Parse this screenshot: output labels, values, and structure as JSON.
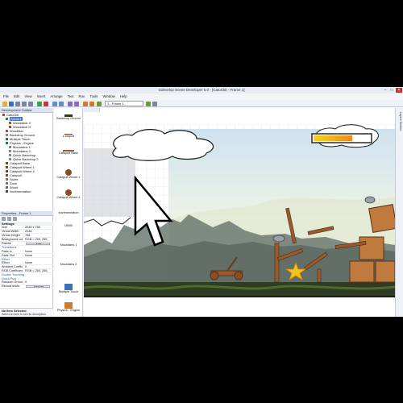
{
  "window": {
    "title": "Gdevelop Scene Developer 5.0 - [CatuCkit - Frame 1]"
  },
  "menu": [
    "File",
    "Edit",
    "View",
    "Insert",
    "Arrange",
    "Text",
    "Run",
    "Tools",
    "Window",
    "Help"
  ],
  "toolbar": {
    "frame_select": "1 - Frame 1"
  },
  "tree": {
    "header": "Development Toolbar",
    "items": [
      {
        "label": "CatuCkit",
        "selected": false,
        "level": 0,
        "color": "#c0392b"
      },
      {
        "label": "Scene1",
        "selected": true,
        "level": 1,
        "color": "#2e7d32"
      },
      {
        "label": "Woodstick V",
        "selected": false,
        "level": 2,
        "color": "#a0522d"
      },
      {
        "label": "Woodstick H",
        "selected": false,
        "level": 2,
        "color": "#a0522d"
      },
      {
        "label": "WoodBox",
        "selected": false,
        "level": 1,
        "color": "#8b5a2b"
      },
      {
        "label": "Backdrop Ground",
        "selected": false,
        "level": 1,
        "color": "#888888"
      },
      {
        "label": "Multiple Touch",
        "selected": false,
        "level": 1,
        "color": "#2a5db0"
      },
      {
        "label": "Physics - Engine",
        "selected": false,
        "level": 1,
        "color": "#2a5db0"
      },
      {
        "label": "Mountains 1",
        "selected": false,
        "level": 2,
        "color": "#888888"
      },
      {
        "label": "Mountains 2",
        "selected": false,
        "level": 2,
        "color": "#888888"
      },
      {
        "label": "Quick Backdrop",
        "selected": false,
        "level": 2,
        "color": "#888888"
      },
      {
        "label": "Quick Backdrop 2",
        "selected": false,
        "level": 2,
        "color": "#888888"
      },
      {
        "label": "Catapult Base",
        "selected": false,
        "level": 1,
        "color": "#8b4513"
      },
      {
        "label": "Catapult Wheel 1",
        "selected": false,
        "level": 1,
        "color": "#8b4513"
      },
      {
        "label": "Catapult Wheel 4",
        "selected": false,
        "level": 1,
        "color": "#8b4513"
      },
      {
        "label": "Catapult",
        "selected": false,
        "level": 1,
        "color": "#8b4513"
      },
      {
        "label": "Stone",
        "selected": false,
        "level": 1,
        "color": "#777777"
      },
      {
        "label": "Zone",
        "selected": false,
        "level": 1,
        "color": "#777777"
      },
      {
        "label": "Wood",
        "selected": false,
        "level": 1,
        "color": "#a0522d"
      },
      {
        "label": "Incrémentation",
        "selected": false,
        "level": 1,
        "color": "#444444"
      }
    ]
  },
  "properties": {
    "header": "Properties - Frame 1",
    "section_settings": "Settings",
    "rows": [
      {
        "name": "Size",
        "value": "2048 x 768"
      },
      {
        "name": "Virtual Width",
        "value": "2048"
      },
      {
        "name": "Virtual Height",
        "value": "768"
      },
      {
        "name": "Background color",
        "value": "RGB = 255, 255,"
      },
      {
        "name": "Palette",
        "value": "Edit"
      }
    ],
    "section_transitions": "Transitions",
    "transitions": [
      {
        "name": "Fade in",
        "value": "None"
      },
      {
        "name": "Fade Out",
        "value": "None"
      }
    ],
    "effect_link": "Effect",
    "effect_row": {
      "name": "Effect",
      "value": "None"
    },
    "physics_rows": [
      {
        "name": "Ambient Coefficient",
        "value": "0"
      },
      {
        "name": "RGB Coefficient",
        "value": "RGB = 255, 255,"
      }
    ],
    "physics_links": [
      "Double Touching",
      "Quick Play"
    ],
    "extra_rows": [
      {
        "name": "Random Grounded",
        "value": "0"
      },
      {
        "name": "Record shots",
        "value": "Record"
      }
    ],
    "desc_title": "No Item Selected",
    "desc_text": "Select an item to see its description"
  },
  "objects": [
    {
      "label": "Backdrop Ground",
      "kind": "ground"
    },
    {
      "label": "Catapult",
      "kind": "catapult-line"
    },
    {
      "label": "Catapult Base",
      "kind": "base"
    },
    {
      "label": "Catapult Wheel 1",
      "kind": "wheel"
    },
    {
      "label": "Catapult Wheel 4",
      "kind": "wheel"
    },
    {
      "label": "Incrémentation",
      "kind": "text"
    },
    {
      "label": "16000",
      "kind": "text"
    },
    {
      "label": "Mountains 1",
      "kind": "mountain"
    },
    {
      "label": "Mountains 2",
      "kind": "mountain"
    },
    {
      "label": "Multiple Touch",
      "kind": "touch"
    },
    {
      "label": "Physics - Engine",
      "kind": "physics"
    }
  ],
  "right_panel": {
    "tab": "Layers Toolbox"
  },
  "colors": {
    "accent": "#3d7be0",
    "sky": "#dbe9f2",
    "ground": "#3b5e1f",
    "wood": "#a05a2c"
  }
}
